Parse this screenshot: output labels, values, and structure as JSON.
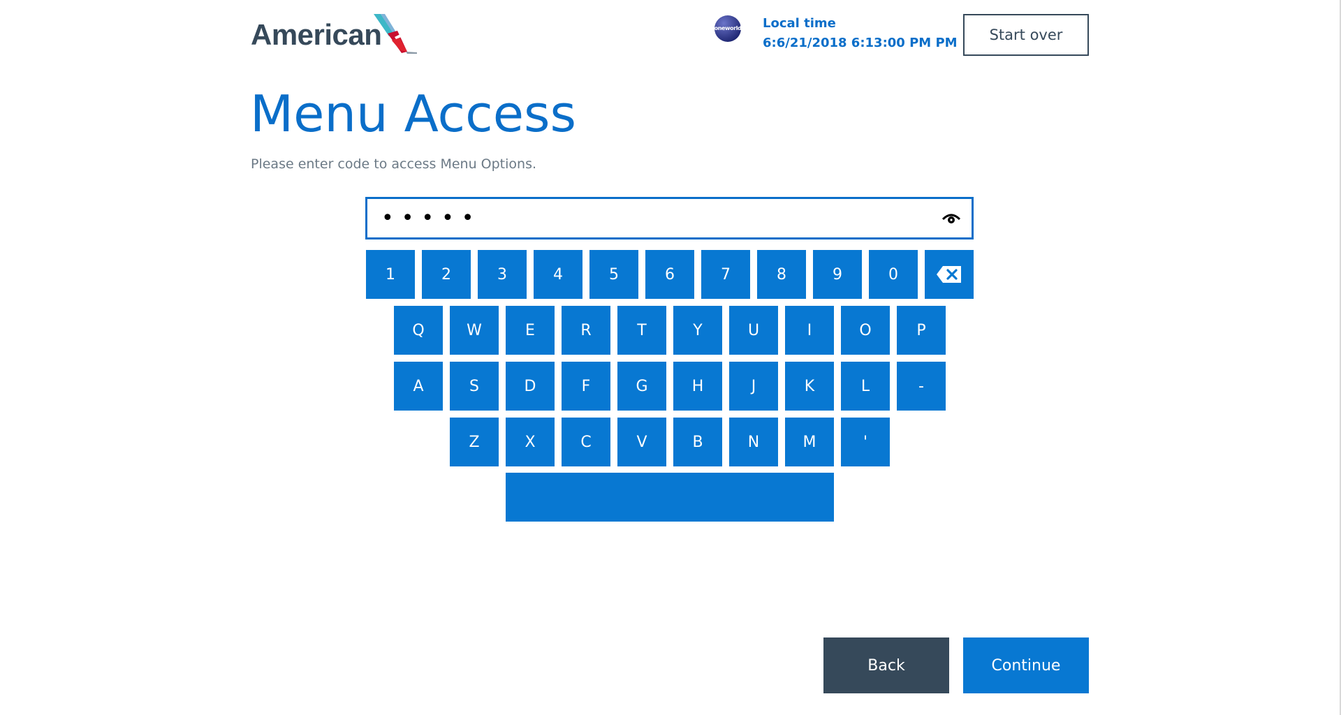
{
  "header": {
    "logo_text": "American",
    "alliance_badge": "oneworld",
    "local_time_label": "Local time",
    "local_time_value": "6:6/21/2018 6:13:00 PM PM",
    "start_over_label": "Start over"
  },
  "main": {
    "title": "Menu Access",
    "subtitle": "Please enter code to access Menu Options.",
    "code_masked": "•••••",
    "reveal_icon": "eye-icon"
  },
  "keyboard": {
    "row1": [
      "1",
      "2",
      "3",
      "4",
      "5",
      "6",
      "7",
      "8",
      "9",
      "0"
    ],
    "backspace_icon": "backspace-icon",
    "row2": [
      "Q",
      "W",
      "E",
      "R",
      "T",
      "Y",
      "U",
      "I",
      "O",
      "P"
    ],
    "row3": [
      "A",
      "S",
      "D",
      "F",
      "G",
      "H",
      "J",
      "K",
      "L",
      "-"
    ],
    "row4": [
      "Z",
      "X",
      "C",
      "V",
      "B",
      "N",
      "M",
      "'"
    ],
    "space_label": ""
  },
  "footer": {
    "back_label": "Back",
    "continue_label": "Continue"
  },
  "colors": {
    "brand_blue": "#0878d2",
    "text_blue": "#0a6ec9",
    "slate": "#36495a",
    "muted_text": "#6c7a86"
  }
}
